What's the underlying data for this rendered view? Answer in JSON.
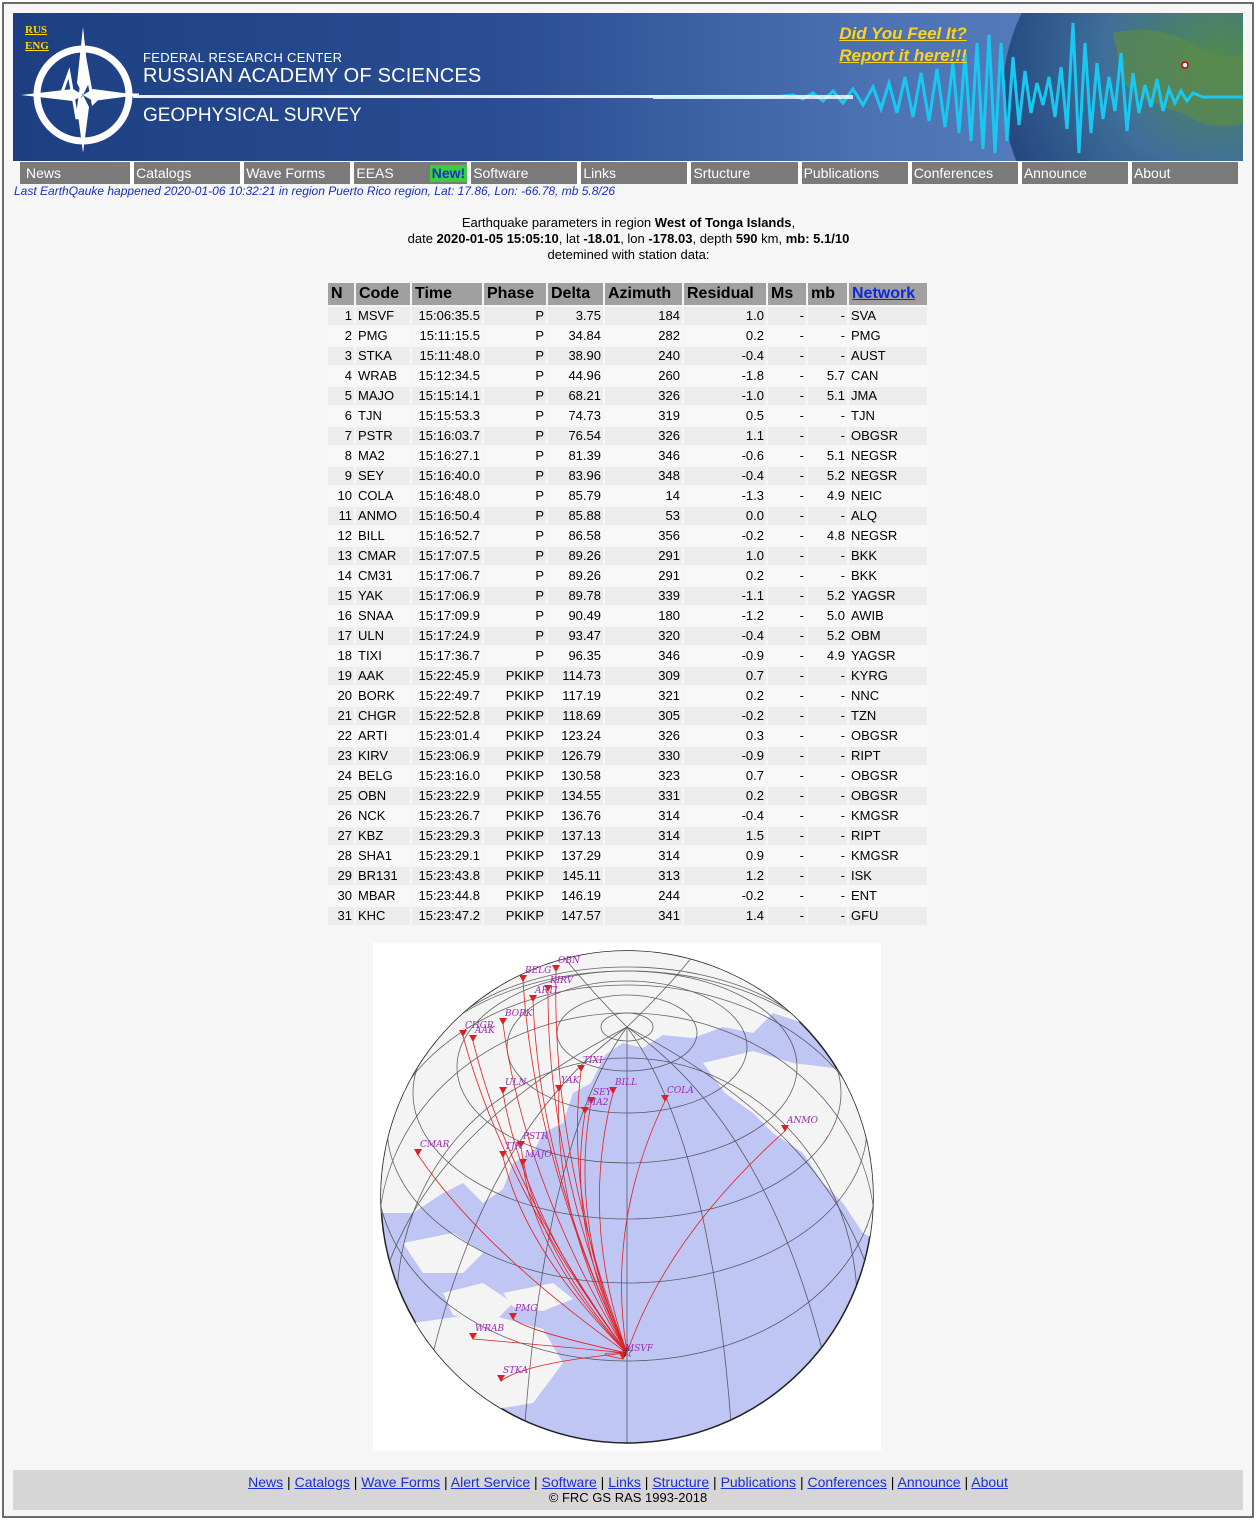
{
  "banner": {
    "lang_rus": "RUS",
    "lang_eng": "ENG",
    "org_line1": "FEDERAL RESEARCH CENTER",
    "org_line2": "RUSSIAN ACADEMY OF SCIENCES",
    "org_line3": "GEOPHYSICAL SURVEY",
    "feel_line1": "Did You Feel It?",
    "feel_line2": "Report it here!!!",
    "colors": {
      "banner": "#2a4d93",
      "wave": "#18c8f0",
      "feel": "#ffd21f"
    }
  },
  "nav": [
    {
      "label": "News"
    },
    {
      "label": "Catalogs"
    },
    {
      "label": "Wave Forms"
    },
    {
      "label": "EEAS",
      "badge": "New!"
    },
    {
      "label": "Software"
    },
    {
      "label": "Links"
    },
    {
      "label": "Srtucture"
    },
    {
      "label": "Publications"
    },
    {
      "label": "Conferences"
    },
    {
      "label": "Announce"
    },
    {
      "label": "About"
    }
  ],
  "last_eq": "Last EarthQauke happened 2020-01-06 10:32:21 in region Puerto Rico region, Lat: 17.86, Lon: -66.78, mb 5.8/26",
  "params": {
    "line1_prefix": "Earthquake parameters in region ",
    "region": "West of Tonga Islands",
    "line1_suffix": ",",
    "date_label": "date ",
    "date": "2020-01-05 15:05:10",
    "lat_label": ", lat ",
    "lat": "-18.01",
    "lon_label": ", lon ",
    "lon": "-178.03",
    "depth_label": ", depth ",
    "depth": "590",
    "km_label": " km, ",
    "mb_label": "mb:",
    "mb": " 5.1/10",
    "line3": "detemined with station data:"
  },
  "table": {
    "headers": [
      "N",
      "Code",
      "Time",
      "Phase",
      "Delta",
      "Azimuth",
      "Residual",
      "Ms",
      "mb",
      "Network"
    ],
    "rows": [
      [
        "1",
        "MSVF",
        "15:06:35.5",
        "P",
        "3.75",
        "184",
        "1.0",
        "-",
        "-",
        "SVA"
      ],
      [
        "2",
        "PMG",
        "15:11:15.5",
        "P",
        "34.84",
        "282",
        "0.2",
        "-",
        "-",
        "PMG"
      ],
      [
        "3",
        "STKA",
        "15:11:48.0",
        "P",
        "38.90",
        "240",
        "-0.4",
        "-",
        "-",
        "AUST"
      ],
      [
        "4",
        "WRAB",
        "15:12:34.5",
        "P",
        "44.96",
        "260",
        "-1.8",
        "-",
        "5.7",
        "CAN"
      ],
      [
        "5",
        "MAJO",
        "15:15:14.1",
        "P",
        "68.21",
        "326",
        "-1.0",
        "-",
        "5.1",
        "JMA"
      ],
      [
        "6",
        "TJN",
        "15:15:53.3",
        "P",
        "74.73",
        "319",
        "0.5",
        "-",
        "-",
        "TJN"
      ],
      [
        "7",
        "PSTR",
        "15:16:03.7",
        "P",
        "76.54",
        "326",
        "1.1",
        "-",
        "-",
        "OBGSR"
      ],
      [
        "8",
        "MA2",
        "15:16:27.1",
        "P",
        "81.39",
        "346",
        "-0.6",
        "-",
        "5.1",
        "NEGSR"
      ],
      [
        "9",
        "SEY",
        "15:16:40.0",
        "P",
        "83.96",
        "348",
        "-0.4",
        "-",
        "5.2",
        "NEGSR"
      ],
      [
        "10",
        "COLA",
        "15:16:48.0",
        "P",
        "85.79",
        "14",
        "-1.3",
        "-",
        "4.9",
        "NEIC"
      ],
      [
        "11",
        "ANMO",
        "15:16:50.4",
        "P",
        "85.88",
        "53",
        "0.0",
        "-",
        "-",
        "ALQ"
      ],
      [
        "12",
        "BILL",
        "15:16:52.7",
        "P",
        "86.58",
        "356",
        "-0.2",
        "-",
        "4.8",
        "NEGSR"
      ],
      [
        "13",
        "CMAR",
        "15:17:07.5",
        "P",
        "89.26",
        "291",
        "1.0",
        "-",
        "-",
        "BKK"
      ],
      [
        "14",
        "CM31",
        "15:17:06.7",
        "P",
        "89.26",
        "291",
        "0.2",
        "-",
        "-",
        "BKK"
      ],
      [
        "15",
        "YAK",
        "15:17:06.9",
        "P",
        "89.78",
        "339",
        "-1.1",
        "-",
        "5.2",
        "YAGSR"
      ],
      [
        "16",
        "SNAA",
        "15:17:09.9",
        "P",
        "90.49",
        "180",
        "-1.2",
        "-",
        "5.0",
        "AWIB"
      ],
      [
        "17",
        "ULN",
        "15:17:24.9",
        "P",
        "93.47",
        "320",
        "-0.4",
        "-",
        "5.2",
        "OBM"
      ],
      [
        "18",
        "TIXI",
        "15:17:36.7",
        "P",
        "96.35",
        "346",
        "-0.9",
        "-",
        "4.9",
        "YAGSR"
      ],
      [
        "19",
        "AAK",
        "15:22:45.9",
        "PKIKP",
        "114.73",
        "309",
        "0.7",
        "-",
        "-",
        "KYRG"
      ],
      [
        "20",
        "BORK",
        "15:22:49.7",
        "PKIKP",
        "117.19",
        "321",
        "0.2",
        "-",
        "-",
        "NNC"
      ],
      [
        "21",
        "CHGR",
        "15:22:52.8",
        "PKIKP",
        "118.69",
        "305",
        "-0.2",
        "-",
        "-",
        "TZN"
      ],
      [
        "22",
        "ARTI",
        "15:23:01.4",
        "PKIKP",
        "123.24",
        "326",
        "0.3",
        "-",
        "-",
        "OBGSR"
      ],
      [
        "23",
        "KIRV",
        "15:23:06.9",
        "PKIKP",
        "126.79",
        "330",
        "-0.9",
        "-",
        "-",
        "RIPT"
      ],
      [
        "24",
        "BELG",
        "15:23:16.0",
        "PKIKP",
        "130.58",
        "323",
        "0.7",
        "-",
        "-",
        "OBGSR"
      ],
      [
        "25",
        "OBN",
        "15:23:22.9",
        "PKIKP",
        "134.55",
        "331",
        "0.2",
        "-",
        "-",
        "OBGSR"
      ],
      [
        "26",
        "NCK",
        "15:23:26.7",
        "PKIKP",
        "136.76",
        "314",
        "-0.4",
        "-",
        "-",
        "KMGSR"
      ],
      [
        "27",
        "KBZ",
        "15:23:29.3",
        "PKIKP",
        "137.13",
        "314",
        "1.5",
        "-",
        "-",
        "RIPT"
      ],
      [
        "28",
        "SHA1",
        "15:23:29.1",
        "PKIKP",
        "137.29",
        "314",
        "0.9",
        "-",
        "-",
        "KMGSR"
      ],
      [
        "29",
        "BR131",
        "15:23:43.8",
        "PKIKP",
        "145.11",
        "313",
        "1.2",
        "-",
        "-",
        "ISK"
      ],
      [
        "30",
        "MBAR",
        "15:23:44.8",
        "PKIKP",
        "146.19",
        "244",
        "-0.2",
        "-",
        "-",
        "ENT"
      ],
      [
        "31",
        "KHC",
        "15:23:47.2",
        "PKIKP",
        "147.57",
        "341",
        "1.4",
        "-",
        "-",
        "GFU"
      ]
    ]
  },
  "map": {
    "stations": [
      {
        "code": "OBN"
      },
      {
        "code": "BELG"
      },
      {
        "code": "KIRV"
      },
      {
        "code": "ARTI"
      },
      {
        "code": "BORK"
      },
      {
        "code": "CHGR"
      },
      {
        "code": "AAK"
      },
      {
        "code": "TIXI"
      },
      {
        "code": "ULN"
      },
      {
        "code": "YAK"
      },
      {
        "code": "BILL"
      },
      {
        "code": "SEY"
      },
      {
        "code": "MA2"
      },
      {
        "code": "COLA"
      },
      {
        "code": "ANMO"
      },
      {
        "code": "CMAR"
      },
      {
        "code": "PSTR"
      },
      {
        "code": "TJN"
      },
      {
        "code": "MAJO"
      },
      {
        "code": "PMG"
      },
      {
        "code": "WRAB"
      },
      {
        "code": "STKA"
      },
      {
        "code": "MSVF"
      }
    ],
    "colors": {
      "ocean": "#c0c6f4",
      "land": "#f4f4f4",
      "path": "#e02020",
      "label": "#9a2ab0"
    }
  },
  "footer": {
    "links": [
      "News",
      "Catalogs",
      "Wave Forms",
      "Alert Service",
      "Software",
      "Links",
      "Structure",
      "Publications",
      "Conferences",
      "Announce",
      "About"
    ],
    "copyright": "© FRC GS RAS 1993-2018"
  }
}
